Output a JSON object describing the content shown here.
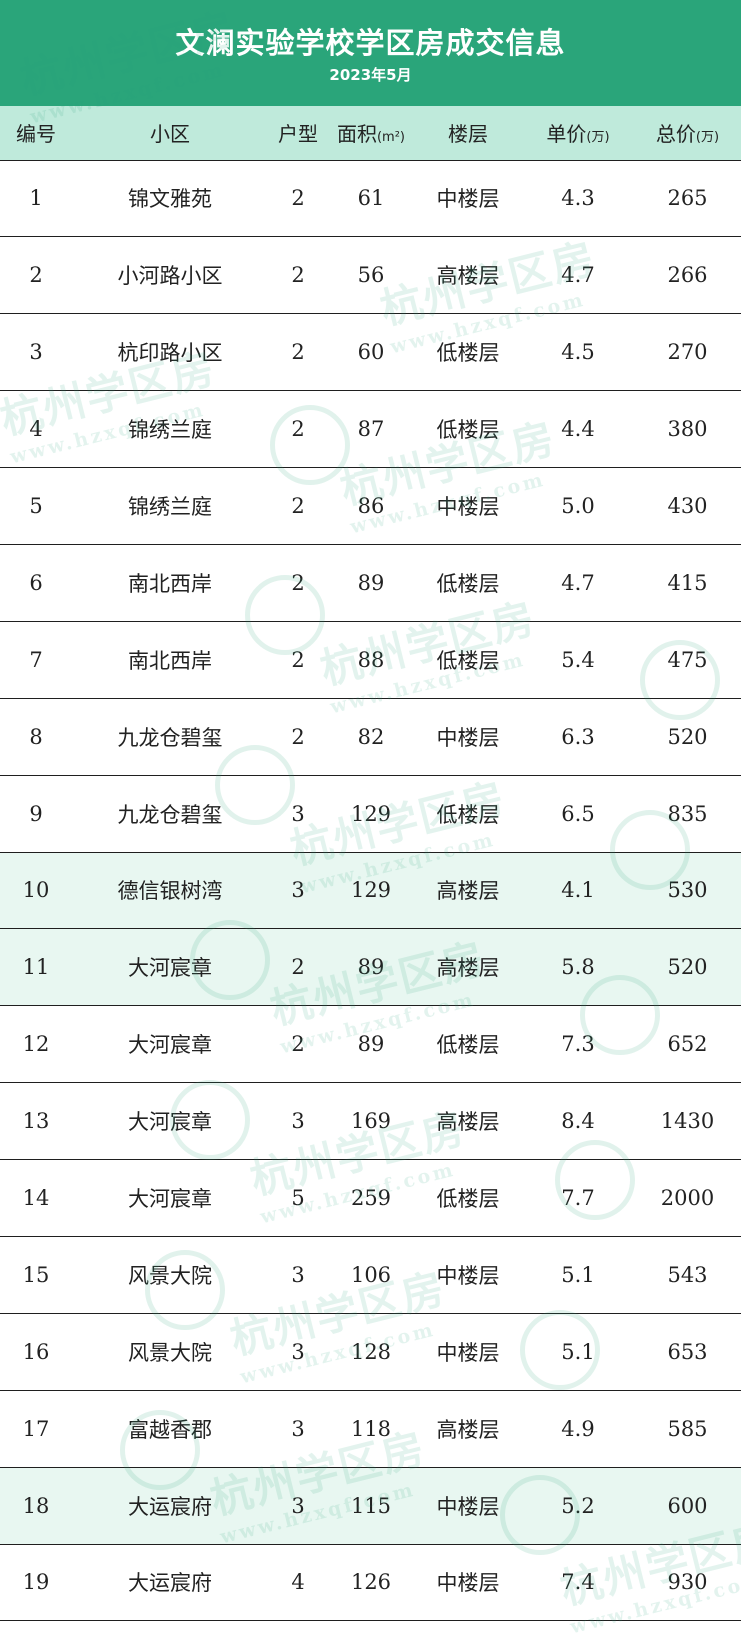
{
  "header": {
    "title": "文澜实验学校学区房成交信息",
    "subtitle": "2023年5月"
  },
  "columns": {
    "no": "编号",
    "xq": "小区",
    "hx": "户型",
    "mj": "面积",
    "mj_unit": "(m²)",
    "lc": "楼层",
    "dj": "单价",
    "dj_unit": "(万)",
    "zj": "总价",
    "zj_unit": "(万)"
  },
  "rows": [
    {
      "no": "1",
      "xq": "锦文雅苑",
      "hx": "2",
      "mj": "61",
      "lc": "中楼层",
      "dj": "4.3",
      "zj": "265",
      "highlight": false
    },
    {
      "no": "2",
      "xq": "小河路小区",
      "hx": "2",
      "mj": "56",
      "lc": "高楼层",
      "dj": "4.7",
      "zj": "266",
      "highlight": false
    },
    {
      "no": "3",
      "xq": "杭印路小区",
      "hx": "2",
      "mj": "60",
      "lc": "低楼层",
      "dj": "4.5",
      "zj": "270",
      "highlight": false
    },
    {
      "no": "4",
      "xq": "锦绣兰庭",
      "hx": "2",
      "mj": "87",
      "lc": "低楼层",
      "dj": "4.4",
      "zj": "380",
      "highlight": false
    },
    {
      "no": "5",
      "xq": "锦绣兰庭",
      "hx": "2",
      "mj": "86",
      "lc": "中楼层",
      "dj": "5.0",
      "zj": "430",
      "highlight": false
    },
    {
      "no": "6",
      "xq": "南北西岸",
      "hx": "2",
      "mj": "89",
      "lc": "低楼层",
      "dj": "4.7",
      "zj": "415",
      "highlight": false
    },
    {
      "no": "7",
      "xq": "南北西岸",
      "hx": "2",
      "mj": "88",
      "lc": "低楼层",
      "dj": "5.4",
      "zj": "475",
      "highlight": false
    },
    {
      "no": "8",
      "xq": "九龙仓碧玺",
      "hx": "2",
      "mj": "82",
      "lc": "中楼层",
      "dj": "6.3",
      "zj": "520",
      "highlight": false
    },
    {
      "no": "9",
      "xq": "九龙仓碧玺",
      "hx": "3",
      "mj": "129",
      "lc": "低楼层",
      "dj": "6.5",
      "zj": "835",
      "highlight": false
    },
    {
      "no": "10",
      "xq": "德信银树湾",
      "hx": "3",
      "mj": "129",
      "lc": "高楼层",
      "dj": "4.1",
      "zj": "530",
      "highlight": true
    },
    {
      "no": "11",
      "xq": "大河宸章",
      "hx": "2",
      "mj": "89",
      "lc": "高楼层",
      "dj": "5.8",
      "zj": "520",
      "highlight": true
    },
    {
      "no": "12",
      "xq": "大河宸章",
      "hx": "2",
      "mj": "89",
      "lc": "低楼层",
      "dj": "7.3",
      "zj": "652",
      "highlight": false
    },
    {
      "no": "13",
      "xq": "大河宸章",
      "hx": "3",
      "mj": "169",
      "lc": "高楼层",
      "dj": "8.4",
      "zj": "1430",
      "highlight": false
    },
    {
      "no": "14",
      "xq": "大河宸章",
      "hx": "5",
      "mj": "259",
      "lc": "低楼层",
      "dj": "7.7",
      "zj": "2000",
      "highlight": false
    },
    {
      "no": "15",
      "xq": "风景大院",
      "hx": "3",
      "mj": "106",
      "lc": "中楼层",
      "dj": "5.1",
      "zj": "543",
      "highlight": false
    },
    {
      "no": "16",
      "xq": "风景大院",
      "hx": "3",
      "mj": "128",
      "lc": "中楼层",
      "dj": "5.1",
      "zj": "653",
      "highlight": false
    },
    {
      "no": "17",
      "xq": "富越香郡",
      "hx": "3",
      "mj": "118",
      "lc": "高楼层",
      "dj": "4.9",
      "zj": "585",
      "highlight": false
    },
    {
      "no": "18",
      "xq": "大运宸府",
      "hx": "3",
      "mj": "115",
      "lc": "中楼层",
      "dj": "5.2",
      "zj": "600",
      "highlight": true
    },
    {
      "no": "19",
      "xq": "大运宸府",
      "hx": "4",
      "mj": "126",
      "lc": "中楼层",
      "dj": "7.4",
      "zj": "930",
      "highlight": false
    }
  ],
  "watermark": {
    "text": "杭州学区房",
    "url": "www.hzxqf.com"
  },
  "colors": {
    "header_bg": "#2aa57a",
    "column_header_bg": "#bfeadb",
    "highlight_row_bg": "#e8f7f1"
  }
}
